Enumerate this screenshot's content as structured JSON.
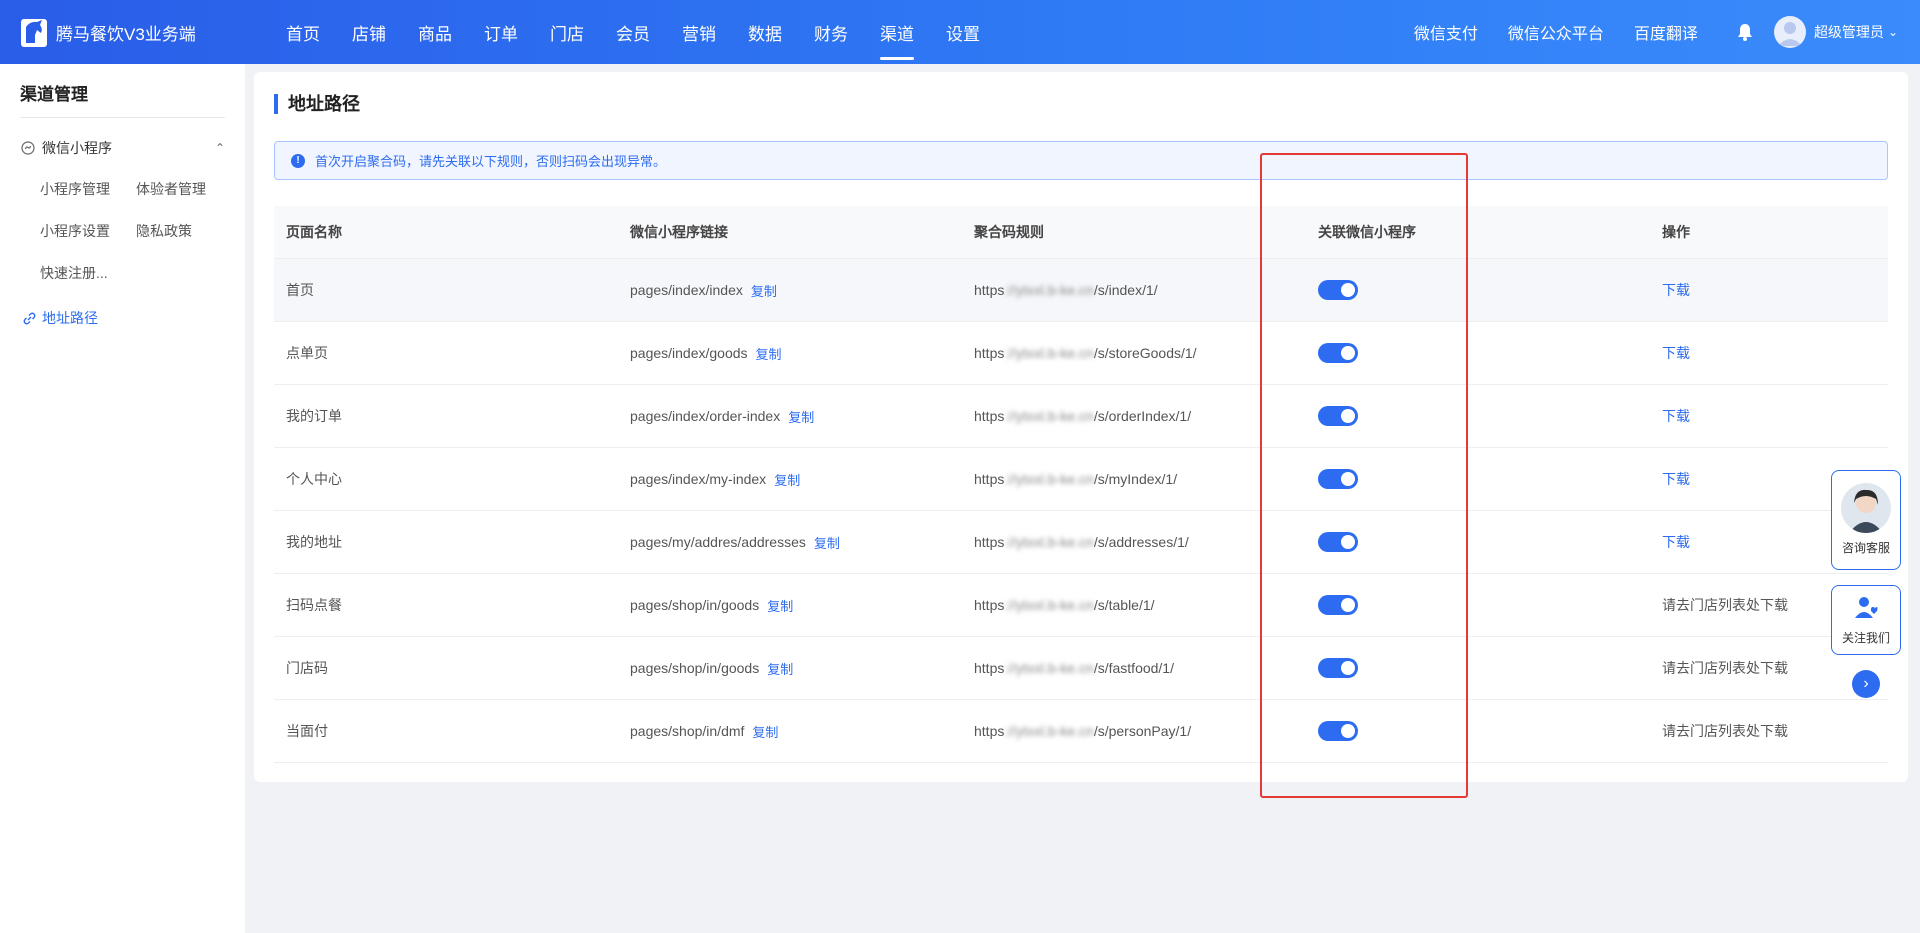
{
  "brand": {
    "name": "腾马餐饮V3业务端"
  },
  "nav": {
    "items": [
      "首页",
      "店铺",
      "商品",
      "订单",
      "门店",
      "会员",
      "营销",
      "数据",
      "财务",
      "渠道",
      "设置"
    ],
    "active_index": 9,
    "right_links": [
      "微信支付",
      "微信公众平台",
      "百度翻译"
    ],
    "user": "超级管理员"
  },
  "sidebar": {
    "title": "渠道管理",
    "group": "微信小程序",
    "subitems": [
      "小程序管理",
      "体验者管理",
      "小程序设置",
      "隐私政策",
      "快速注册..."
    ],
    "active_link": "地址路径"
  },
  "main": {
    "title": "地址路径",
    "alert": "首次开启聚合码，请先关联以下规则，否则扫码会出现异常。",
    "columns": [
      "页面名称",
      "微信小程序链接",
      "聚合码规则",
      "关联微信小程序",
      "操作"
    ],
    "copy_label": "复制",
    "rows": [
      {
        "name": "首页",
        "link": "pages/index/index",
        "rule_prefix": "https",
        "rule_host": "://ytxxl.b-ke.cn",
        "rule_path": "/s/index/1/",
        "linked": true,
        "action": "下载",
        "action_link": true
      },
      {
        "name": "点单页",
        "link": "pages/index/goods",
        "rule_prefix": "https",
        "rule_host": "://ytxxl.b-ke.cn",
        "rule_path": "/s/storeGoods/1/",
        "linked": true,
        "action": "下载",
        "action_link": true
      },
      {
        "name": "我的订单",
        "link": "pages/index/order-index",
        "rule_prefix": "https",
        "rule_host": "://ytxxl.b-ke.cn",
        "rule_path": "/s/orderIndex/1/",
        "linked": true,
        "action": "下载",
        "action_link": true
      },
      {
        "name": "个人中心",
        "link": "pages/index/my-index",
        "rule_prefix": "https",
        "rule_host": "://ytxxl.b-ke.cn",
        "rule_path": "/s/myIndex/1/",
        "linked": true,
        "action": "下载",
        "action_link": true
      },
      {
        "name": "我的地址",
        "link": "pages/my/addres/addresses",
        "rule_prefix": "https",
        "rule_host": "://ytxxl.b-ke.cn",
        "rule_path": "/s/addresses/1/",
        "linked": true,
        "action": "下载",
        "action_link": true
      },
      {
        "name": "扫码点餐",
        "link": "pages/shop/in/goods",
        "rule_prefix": "https",
        "rule_host": "://ytxxl.b-ke.cn",
        "rule_path": "/s/table/1/",
        "linked": true,
        "action": "请去门店列表处下载",
        "action_link": false
      },
      {
        "name": "门店码",
        "link": "pages/shop/in/goods",
        "rule_prefix": "https",
        "rule_host": "://ytxxl.b-ke.cn",
        "rule_path": "/s/fastfood/1/",
        "linked": true,
        "action": "请去门店列表处下载",
        "action_link": false
      },
      {
        "name": "当面付",
        "link": "pages/shop/in/dmf",
        "rule_prefix": "https",
        "rule_host": "://ytxxl.b-ke.cn",
        "rule_path": "/s/personPay/1/",
        "linked": true,
        "action": "请去门店列表处下载",
        "action_link": false
      }
    ]
  },
  "float": {
    "service_label": "咨询客服",
    "follow_label": "关注我们"
  },
  "colors": {
    "primary": "#2d6cf0",
    "highlight": "#e53935"
  }
}
